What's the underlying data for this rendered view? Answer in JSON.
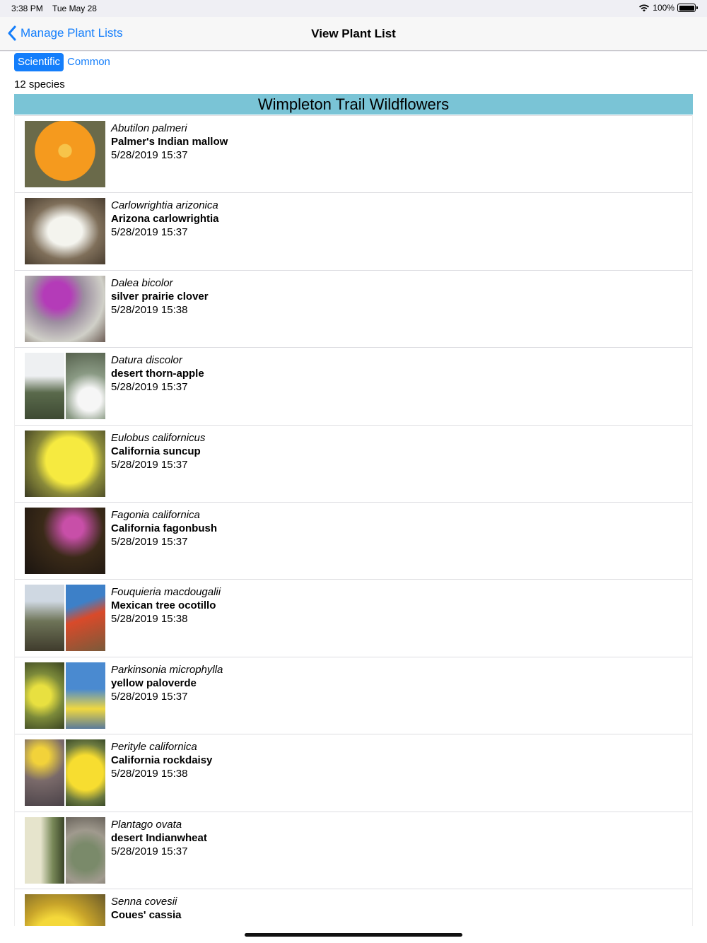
{
  "status": {
    "time": "3:38 PM",
    "date": "Tue May 28",
    "battery": "100%"
  },
  "nav": {
    "back_label": "Manage Plant Lists",
    "title": "View Plant List"
  },
  "segments": {
    "scientific": "Scientific",
    "common": "Common",
    "selected": "Scientific"
  },
  "species_count": "12 species",
  "list_title": "Wimpleton Trail Wildflowers",
  "colors": {
    "accent": "#147efb",
    "header_bg": "#7ac4d6"
  },
  "plants": [
    {
      "scientific": "Abutilon palmeri",
      "common": "Palmer's Indian mallow",
      "date": "5/28/2019 15:37",
      "thumb": [
        "radial-gradient(circle at 50% 45%, #f7c44a 0 12%, #f59a1e 13% 55%, #6a6a4a 56%)"
      ]
    },
    {
      "scientific": "Carlowrightia arizonica",
      "common": "Arizona carlowrightia",
      "date": "5/28/2019 15:37",
      "thumb": [
        "radial-gradient(ellipse at 50% 50%, #f4f4ee 0 30%, #7f6f5a 60%, #4a3e30 100%)"
      ]
    },
    {
      "scientific": "Dalea bicolor",
      "common": "silver prairie clover",
      "date": "5/28/2019 15:38",
      "thumb": [
        "radial-gradient(circle at 40% 30%, #b43bb8 0 20%, #9d8fa0 40%, #d0d0c8 70%, #6d5d55 100%)"
      ]
    },
    {
      "scientific": "Datura discolor",
      "common": "desert thorn-apple",
      "date": "5/28/2019 15:37",
      "thumb": [
        "linear-gradient(180deg, #eef0f2 0 35%, #5a6a4c 60%, #3e4a33 100%)",
        "radial-gradient(circle at 60% 70%, #f6f6f6 0 22%, #8a9a84 50%, #55604c 100%)"
      ]
    },
    {
      "scientific": "Eulobus californicus",
      "common": "California suncup",
      "date": "5/28/2019 15:37",
      "thumb": [
        "radial-gradient(circle at 55% 45%, #f6ea40 0 40%, #8a8a3a 60%, #3a3a22 100%)"
      ]
    },
    {
      "scientific": "Fagonia californica",
      "common": "California fagonbush",
      "date": "5/28/2019 15:37",
      "thumb": [
        "radial-gradient(circle at 60% 30%, #c84fa8 0 15%, #3a2a18 45%, #1a1410 100%)"
      ]
    },
    {
      "scientific": "Fouquieria macdougalii",
      "common": "Mexican tree ocotillo",
      "date": "5/28/2019 15:38",
      "thumb": [
        "linear-gradient(180deg, #cfd8e2 0 25%, #6e7458 55%, #3f3b2c 100%)",
        "linear-gradient(160deg, #3d80c8 0 30%, #d94a2a 50%, #7a5a3a 100%)"
      ]
    },
    {
      "scientific": "Parkinsonia microphylla",
      "common": "yellow paloverde",
      "date": "5/28/2019 15:37",
      "thumb": [
        "radial-gradient(circle at 40% 50%, #e8e040 0 25%, #7c8a3a 55%, #3a4422 100%)",
        "linear-gradient(180deg, #4a8ad0 0 40%, #f0d840 70%, #5a7a9a 100%)"
      ]
    },
    {
      "scientific": "Perityle californica",
      "common": "California rockdaisy",
      "date": "5/28/2019 15:38",
      "thumb": [
        "radial-gradient(circle at 40% 25%, #f2d23a 0 15%, #7a6a6a 45%, #4a4248 100%)",
        "radial-gradient(circle at 50% 50%, #f7dd30 0 45%, #6c7a40 75%, #3a4a28 100%)"
      ]
    },
    {
      "scientific": "Plantago ovata",
      "common": "desert Indianwheat",
      "date": "5/28/2019 15:37",
      "thumb": [
        "linear-gradient(90deg, #e6e4cc 0 40%, #7a8a5a 70%, #3a4428 100%)",
        "radial-gradient(circle at 50% 60%, #7a8a6a 0 30%, #a09a8e 60%, #6a645c 100%)"
      ]
    },
    {
      "scientific": "Senna covesii",
      "common": "Coues' cassia",
      "date": "",
      "thumb": [
        "radial-gradient(circle at 40% 70%, #f4d83a 0 35%, #c8a42a 55%, #6a5a2a 100%)"
      ]
    }
  ]
}
